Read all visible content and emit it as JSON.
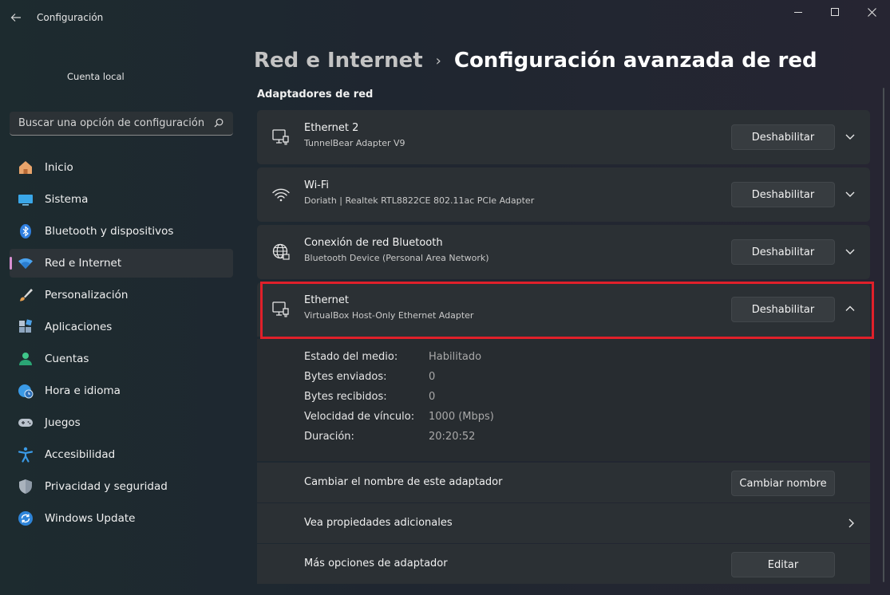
{
  "window": {
    "app_title": "Configuración",
    "back_icon": "arrow-left-icon"
  },
  "account": {
    "name": "Cuenta local"
  },
  "search": {
    "placeholder": "Buscar una opción de configuración"
  },
  "sidebar": {
    "items": [
      {
        "label": "Inicio",
        "icon": "home-icon"
      },
      {
        "label": "Sistema",
        "icon": "monitor-icon"
      },
      {
        "label": "Bluetooth y dispositivos",
        "icon": "bluetooth-icon"
      },
      {
        "label": "Red e Internet",
        "icon": "wifi-icon",
        "active": true
      },
      {
        "label": "Personalización",
        "icon": "brush-icon"
      },
      {
        "label": "Aplicaciones",
        "icon": "apps-icon"
      },
      {
        "label": "Cuentas",
        "icon": "person-icon"
      },
      {
        "label": "Hora e idioma",
        "icon": "clock-globe-icon"
      },
      {
        "label": "Juegos",
        "icon": "gamepad-icon"
      },
      {
        "label": "Accesibilidad",
        "icon": "accessibility-icon"
      },
      {
        "label": "Privacidad y seguridad",
        "icon": "shield-icon"
      },
      {
        "label": "Windows Update",
        "icon": "update-icon"
      }
    ]
  },
  "breadcrumb": {
    "parent": "Red e Internet",
    "separator": "›",
    "current": "Configuración avanzada de red"
  },
  "section": {
    "title": "Adaptadores de red"
  },
  "adapters": [
    {
      "name": "Ethernet 2",
      "description": "TunnelBear Adapter V9",
      "button": "Deshabilitar",
      "icon": "ethernet-icon",
      "expanded": false
    },
    {
      "name": "Wi-Fi",
      "description": "Doriath | Realtek RTL8822CE 802.11ac PCIe Adapter",
      "button": "Deshabilitar",
      "icon": "wifi-icon",
      "expanded": false
    },
    {
      "name": "Conexión de red Bluetooth",
      "description": "Bluetooth Device (Personal Area Network)",
      "button": "Deshabilitar",
      "icon": "globe-icon",
      "expanded": false
    },
    {
      "name": "Ethernet",
      "description": "VirtualBox Host-Only Ethernet Adapter",
      "button": "Deshabilitar",
      "icon": "ethernet-icon",
      "expanded": true
    }
  ],
  "details": [
    {
      "label": "Estado del medio:",
      "value": "Habilitado"
    },
    {
      "label": "Bytes enviados:",
      "value": "0"
    },
    {
      "label": "Bytes recibidos:",
      "value": "0"
    },
    {
      "label": "Velocidad de vínculo:",
      "value": "1000 (Mbps)"
    },
    {
      "label": "Duración:",
      "value": "20:20:52"
    }
  ],
  "actions": {
    "rename": {
      "label": "Cambiar el nombre de este adaptador",
      "button": "Cambiar nombre"
    },
    "properties": {
      "label": "Vea propiedades adicionales"
    },
    "more": {
      "label": "Más opciones de adaptador",
      "button": "Editar"
    }
  },
  "colors": {
    "accent_active": "#d98fd1",
    "highlight_border": "#e0202a",
    "card_bg": "#2b3034"
  }
}
